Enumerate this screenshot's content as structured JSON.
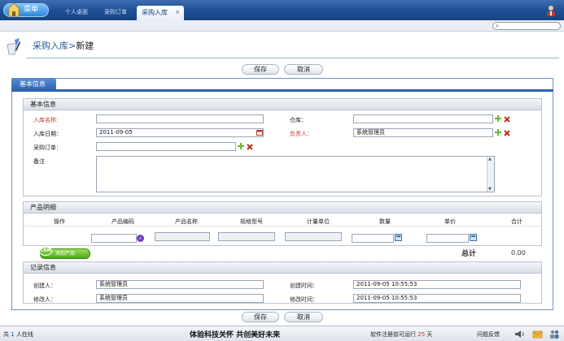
{
  "header": {
    "menu_label": "菜单",
    "tabs": [
      {
        "label": "个人桌面"
      },
      {
        "label": "采购订单"
      },
      {
        "label": "采购入库",
        "close": "×"
      }
    ]
  },
  "page": {
    "title_parent": "采购入库",
    "title_sep": ">",
    "title_current": "新建"
  },
  "toolbar": {
    "save_label": "保存",
    "cancel_label": "取消"
  },
  "form_tab": "基本信息",
  "basic": {
    "section_title": "基本信息",
    "entry_name_label": "入库名称：",
    "entry_name_value": "",
    "warehouse_label": "仓库：",
    "warehouse_value": "",
    "entry_date_label": "入库日期：",
    "entry_date_value": "2011-09-05",
    "manager_label": "负责人：",
    "manager_value": "系统管理员",
    "order_label": "采购订单：",
    "order_value": "",
    "note_label": "备注",
    "note_value": ""
  },
  "products": {
    "section_title": "产品明细",
    "columns": [
      "操作",
      "产品编码",
      "产品名称",
      "规格型号",
      "计量单位",
      "数量",
      "单价",
      "合计"
    ],
    "add_button": "添加产品",
    "add_badge": "CRM",
    "total_label": "总计",
    "total_value": "0.00"
  },
  "record": {
    "section_title": "记录信息",
    "creator_label": "创建人：",
    "creator_value": "系统管理员",
    "created_label": "创建时间：",
    "created_value": "2011-09-05 10:55:53",
    "modifier_label": "修改人：",
    "modifier_value": "系统管理员",
    "modified_label": "修改时间：",
    "modified_value": "2011-09-05 10:55:53"
  },
  "status": {
    "online_prefix": "共",
    "online_count": "1",
    "online_suffix": "人在线",
    "slogan": "体验科技关怀  共创美好未来",
    "trial_prefix": "软件注册前可运行",
    "trial_days": "25",
    "trial_suffix": "天",
    "feedback": "问题反馈"
  },
  "colors": {
    "accent": "#2d64b4",
    "required": "#c0392b",
    "add": "#4fa51f"
  }
}
